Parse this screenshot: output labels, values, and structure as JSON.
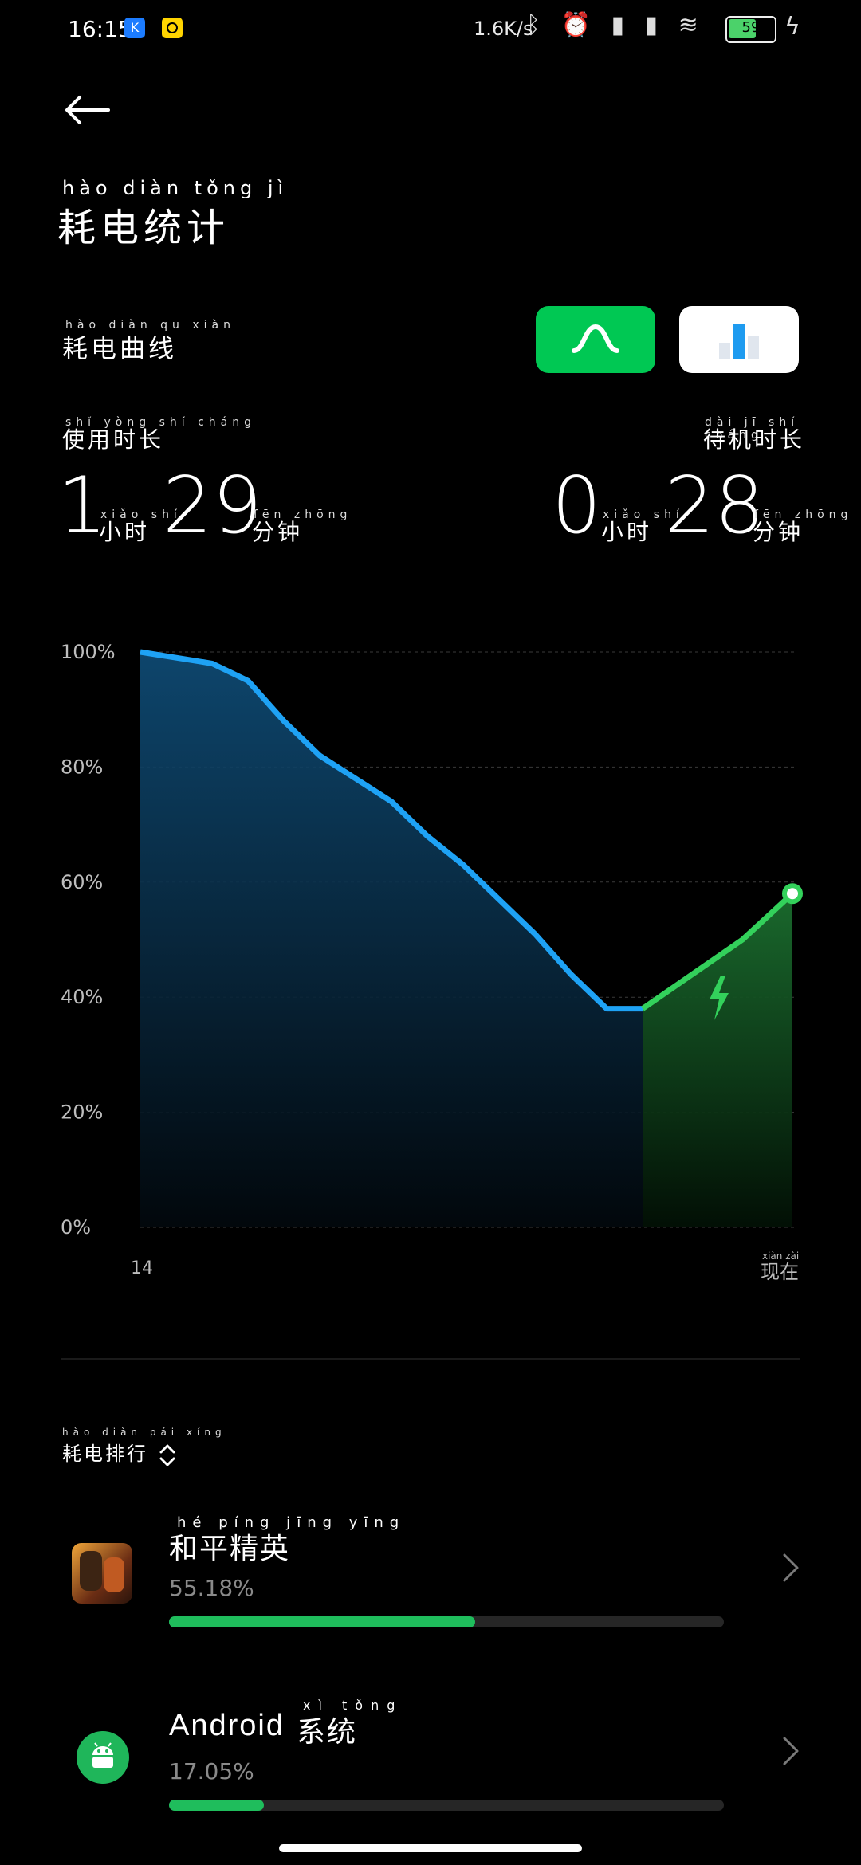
{
  "status_bar": {
    "time": "16:15",
    "net_speed": "1.6K/s",
    "icons": [
      "bluetooth-icon",
      "alarm-icon",
      "hd-icon",
      "signal-icon",
      "signal-icon",
      "wifi-icon"
    ],
    "battery": "59",
    "charging": true
  },
  "header": {
    "title_pinyin": "hào diàn tǒng jì",
    "title": "耗电统计"
  },
  "curve_section": {
    "label_pinyin": "hào diàn qū xiàn",
    "label": "耗电曲线"
  },
  "usage": {
    "usage_label_pinyin": "shǐ yòng shí cháng",
    "usage_label": "使用时长",
    "usage_hours": "1",
    "usage_minutes": "29",
    "standby_label_pinyin": "dài jī shí cháng",
    "standby_label": "待机时长",
    "standby_hours": "0",
    "standby_minutes": "28",
    "hour_unit_pinyin": "xiǎo shí",
    "hour_unit": "小时",
    "minute_unit_pinyin": "fēn zhōng",
    "minute_unit": "分钟"
  },
  "chart_data": {
    "type": "area",
    "y_ticks": [
      "100%",
      "80%",
      "60%",
      "40%",
      "20%",
      "0%"
    ],
    "x_start_label": "14",
    "x_end_label_pinyin": "xiàn zài",
    "x_end_label": "现在",
    "ylim": [
      0,
      100
    ],
    "series": [
      {
        "kind": "discharge",
        "color": "#1ea2f5",
        "values": [
          100,
          99,
          98,
          95,
          88,
          82,
          78,
          74,
          68,
          63,
          57,
          51,
          44,
          38,
          38
        ]
      },
      {
        "kind": "charge",
        "color": "#33d15b",
        "values": [
          38,
          44,
          50,
          58
        ]
      }
    ]
  },
  "ranking": {
    "title_pinyin": "hào diàn pái xíng",
    "title": "耗电排行",
    "items": [
      {
        "name_pinyin": "hé píng jīng yīng",
        "name": "和平精英",
        "percent": "55.18%",
        "fraction": 0.5518,
        "icon": "game-icon"
      },
      {
        "name_prefix": "Android",
        "name_pinyin": "xì tǒng",
        "name": "系统",
        "percent": "17.05%",
        "fraction": 0.1705,
        "icon": "android-icon"
      }
    ]
  }
}
